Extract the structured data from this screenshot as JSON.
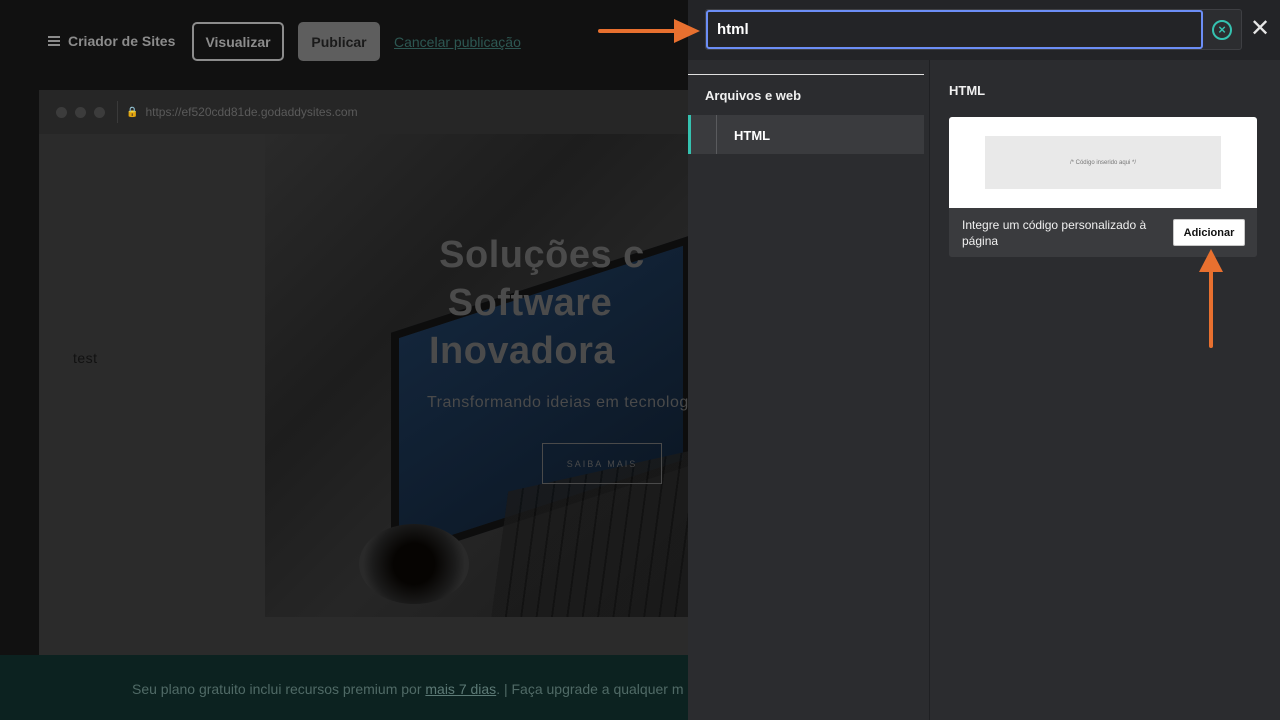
{
  "editor": {
    "menu_label": "Criador de Sites",
    "preview_button": "Visualizar",
    "publish_button": "Publicar",
    "cancel_link": "Cancelar publicação",
    "browser": {
      "url": "https://ef520cdd81de.godaddysites.com"
    },
    "page": {
      "side_text": "test",
      "hero_title_lines": [
        "Soluções c",
        "Software",
        "Inovadora"
      ],
      "hero_subtitle": "Transformando ideias em tecnolog",
      "hero_button": "SAIBA MAIS"
    },
    "banner": {
      "text_before": "Seu plano gratuito inclui recursos premium por ",
      "link": "mais 7 dias",
      "text_after": ". | Faça upgrade a qualquer m"
    }
  },
  "panel": {
    "search": {
      "value": "html",
      "placeholder": ""
    },
    "clear_icon": "circle-x-icon",
    "close_icon": "close-icon",
    "categories": {
      "heading": "Arquivos e web",
      "items": [
        {
          "label": "HTML",
          "selected": true
        }
      ]
    },
    "results": {
      "heading": "HTML",
      "card": {
        "preview_code": "/* Código inserido aqui */",
        "description": "Integre um código personalizado à página",
        "add_button": "Adicionar"
      }
    }
  },
  "colors": {
    "accent_teal": "#35c2b0",
    "search_focus": "#6c8ef6",
    "annotation_arrow": "#e8702f"
  }
}
